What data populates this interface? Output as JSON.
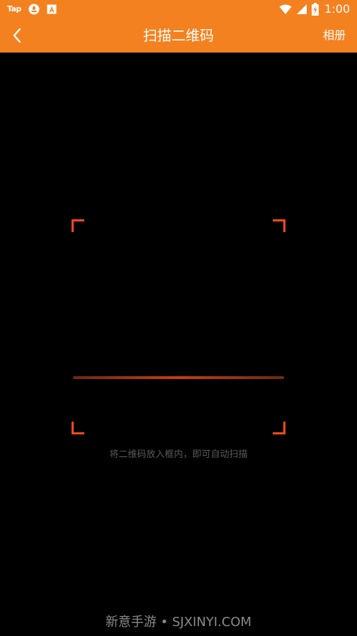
{
  "status_bar": {
    "app_badge": "Tap",
    "icons": [
      "tap-logo-icon",
      "recycle-icon",
      "font-app-icon",
      "wifi-icon",
      "signal-icon",
      "battery-charging-icon"
    ],
    "time": "1:00",
    "background": "#F4811F"
  },
  "app_bar": {
    "back_icon": "chevron-left-icon",
    "title": "扫描二维码",
    "album_label": "相册",
    "background": "#F4811F"
  },
  "scanner": {
    "corner_color": "#FF4A1A",
    "hint": "将二维码放入框内，即可自动扫描"
  },
  "watermark": "新意手游 • SJXINYI.COM"
}
